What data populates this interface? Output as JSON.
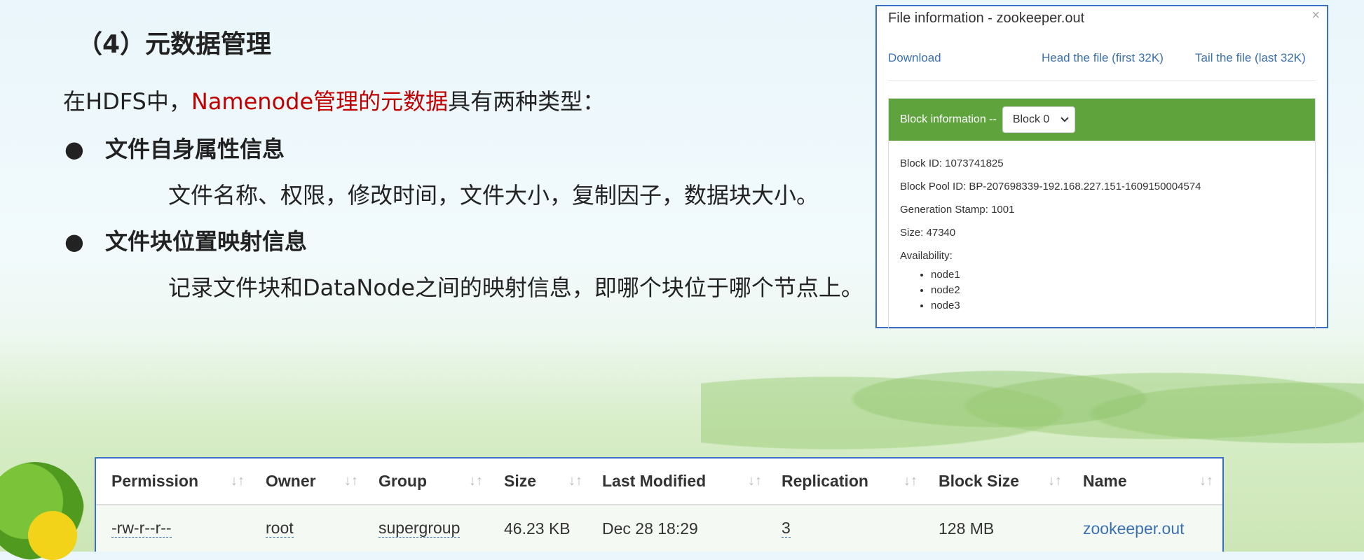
{
  "slide": {
    "heading": "（4）元数据管理",
    "intro_prefix": "在HDFS中，",
    "intro_highlight": "Namenode管理的元数据",
    "intro_suffix": "具有两种类型：",
    "bullet_symbol": "●",
    "bullets": [
      {
        "title": "文件自身属性信息",
        "detail": "文件名称、权限，修改时间，文件大小，复制因子，数据块大小。"
      },
      {
        "title": "文件块位置映射信息",
        "detail": "记录文件块和DataNode之间的映射信息，即哪个块位于哪个节点上。"
      }
    ]
  },
  "dialog": {
    "title": "File information - zookeeper.out",
    "close_glyph": "×",
    "links": {
      "download": "Download",
      "head": "Head the file (first 32K)",
      "tail": "Tail the file (last 32K)"
    },
    "block_label": "Block information --",
    "block_selected": "Block 0",
    "block_id": "Block ID: 1073741825",
    "block_pool": "Block Pool ID: BP-207698339-192.168.227.151-1609150004574",
    "generation_stamp": "Generation Stamp: 1001",
    "size": "Size: 47340",
    "availability": "Availability:",
    "nodes": [
      "node1",
      "node2",
      "node3"
    ],
    "header_color": "#5ea33b"
  },
  "table": {
    "columns": [
      "Permission",
      "Owner",
      "Group",
      "Size",
      "Last Modified",
      "Replication",
      "Block Size",
      "Name"
    ],
    "sort_glyph": "↓↑",
    "row": {
      "permission": "-rw-r--r--",
      "owner": "root",
      "group": "supergroup",
      "size": "46.23 KB",
      "modified": "Dec 28 18:29",
      "replication": "3",
      "block_size": "128 MB",
      "name": "zookeeper.out"
    }
  }
}
